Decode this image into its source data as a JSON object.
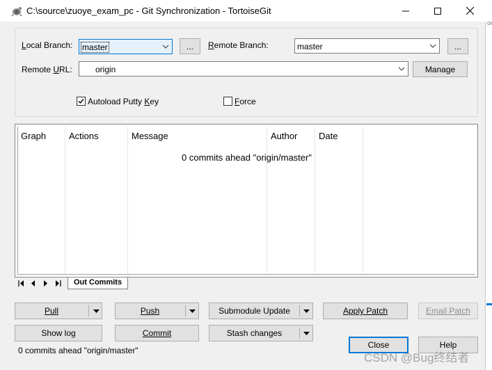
{
  "window": {
    "title": "C:\\source\\zuoye_exam_pc - Git Synchronization - TortoiseGit"
  },
  "branch": {
    "local_label_u": "L",
    "local_label_rest": "ocal Branch:",
    "local_value": "master",
    "local_browse": "...",
    "remote_label_u": "R",
    "remote_label_rest": "emote Branch:",
    "remote_value": "master",
    "remote_browse": "..."
  },
  "remote_url": {
    "label_pre": "Remote ",
    "label_u": "U",
    "label_post": "RL:",
    "value": "origin",
    "manage": "Manage"
  },
  "options": {
    "autoload_pre": "Autoload Putty ",
    "autoload_u": "K",
    "autoload_post": "ey",
    "autoload_checked": true,
    "force_u": "F",
    "force_post": "orce",
    "force_checked": false
  },
  "commit_list": {
    "columns": [
      "Graph",
      "Actions",
      "Message",
      "Author",
      "Date"
    ],
    "empty_message": "0 commits ahead \"origin/master\""
  },
  "tabs": {
    "active": "Out Commits"
  },
  "buttons": {
    "pull": "Pull",
    "push": "Push",
    "submodule_update": "Submodule Update",
    "apply_patch": "Apply Patch",
    "email_patch": "Email Patch",
    "show_log": "Show log",
    "commit": "Commit",
    "stash_changes": "Stash changes",
    "close": "Close",
    "help": "Help"
  },
  "status_text": "0 commits ahead \"origin/master\"",
  "watermark": "CSDN @Bug终结者",
  "edge_text": "oo",
  "colors": {
    "accent": "#0078d7",
    "face": "#f0f0f0",
    "button": "#e1e1e1"
  }
}
